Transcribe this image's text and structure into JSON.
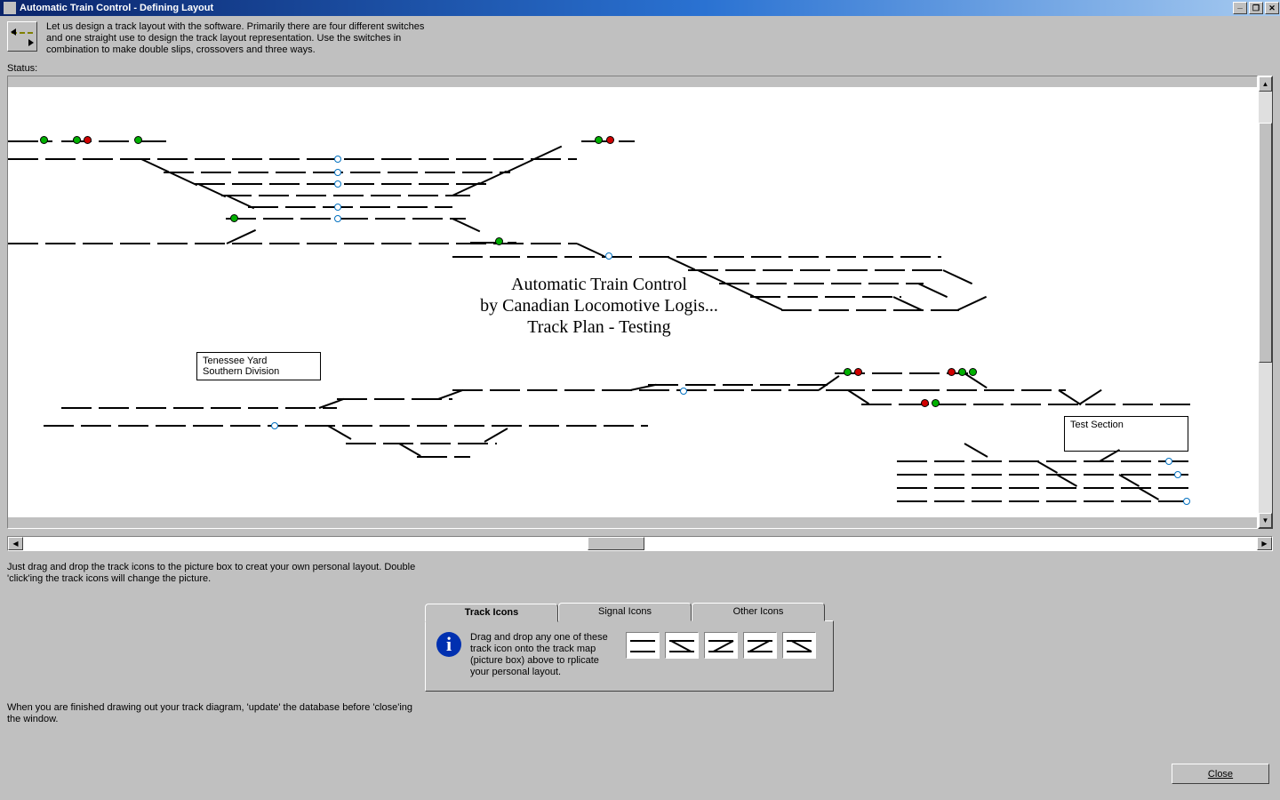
{
  "window": {
    "title": "Automatic Train Control - Defining Layout"
  },
  "header": {
    "help": "Let us design a track layout with the software. Primarily there are four different switches and one straight use to design the track layout representation. Use the switches in combination to make double slips, crossovers and three ways."
  },
  "status": {
    "label": "Status:"
  },
  "map": {
    "title_line1": "Automatic Train Control",
    "title_line2": "by Canadian Locomotive Logis...",
    "title_line3": "Track Plan - Testing",
    "label_yard_line1": "Tenessee Yard",
    "label_yard_line2": "Southern Division",
    "label_test": "Test Section"
  },
  "hints": {
    "below_map": "Just drag and drop the track icons to the picture box to creat your own personal layout. Double 'click'ing the track icons will change the picture.",
    "bottom": "When you are finished drawing out your track diagram, 'update' the database before 'close'ing the window."
  },
  "tabs": {
    "items": [
      "Track Icons",
      "Signal Icons",
      "Other Icons"
    ],
    "active_index": 0,
    "body_text": "Drag and drop any one of these track icon onto the track map (picture box) above to rplicate your personal layout."
  },
  "buttons": {
    "close": "Close"
  }
}
